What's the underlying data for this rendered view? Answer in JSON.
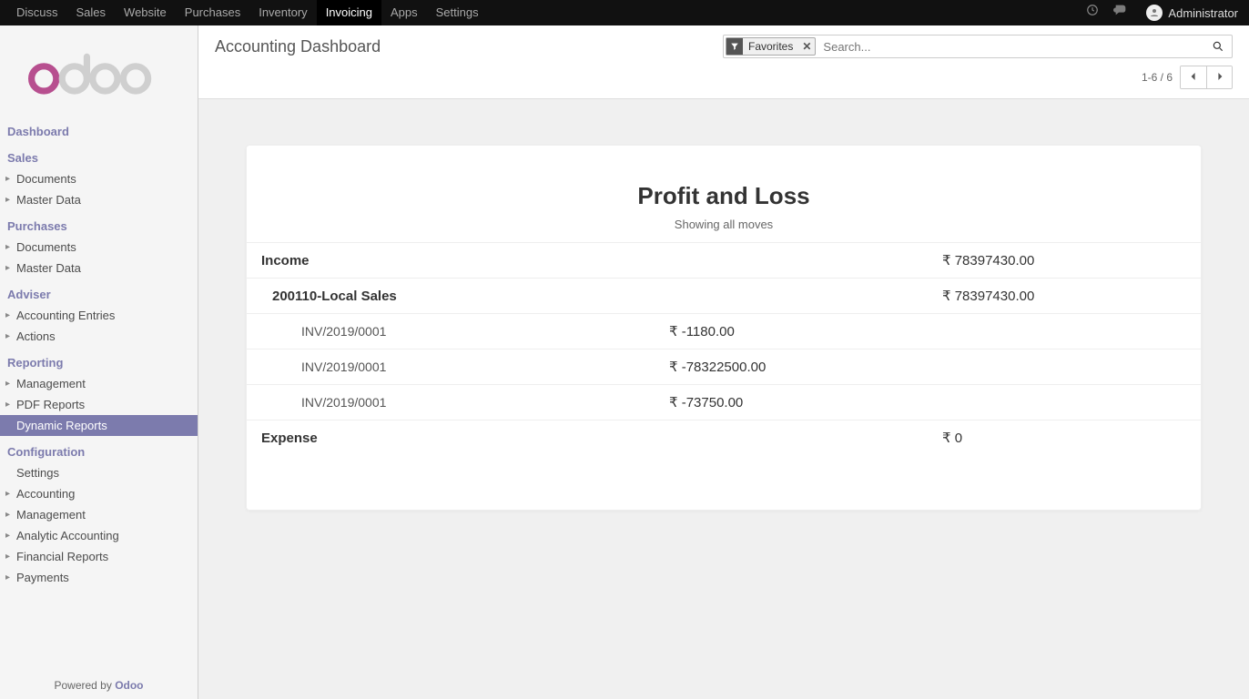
{
  "topmenu": {
    "items": [
      "Discuss",
      "Sales",
      "Website",
      "Purchases",
      "Inventory",
      "Invoicing",
      "Apps",
      "Settings"
    ],
    "active_index": 5,
    "user": "Administrator"
  },
  "sidebar": {
    "groups": [
      {
        "header": "Dashboard",
        "items": []
      },
      {
        "header": "Sales",
        "items": [
          {
            "label": "Documents",
            "caret": true
          },
          {
            "label": "Master Data",
            "caret": true
          }
        ]
      },
      {
        "header": "Purchases",
        "items": [
          {
            "label": "Documents",
            "caret": true
          },
          {
            "label": "Master Data",
            "caret": true
          }
        ]
      },
      {
        "header": "Adviser",
        "items": [
          {
            "label": "Accounting Entries",
            "caret": true
          },
          {
            "label": "Actions",
            "caret": true
          }
        ]
      },
      {
        "header": "Reporting",
        "items": [
          {
            "label": "Management",
            "caret": true
          },
          {
            "label": "PDF Reports",
            "caret": true
          },
          {
            "label": "Dynamic Reports",
            "caret": false,
            "active": true
          }
        ]
      },
      {
        "header": "Configuration",
        "items": [
          {
            "label": "Settings",
            "caret": false
          },
          {
            "label": "Accounting",
            "caret": true
          },
          {
            "label": "Management",
            "caret": true
          },
          {
            "label": "Analytic Accounting",
            "caret": true
          },
          {
            "label": "Financial Reports",
            "caret": true
          },
          {
            "label": "Payments",
            "caret": true
          }
        ]
      }
    ],
    "footer_prefix": "Powered by ",
    "footer_brand": "Odoo"
  },
  "breadcrumb": "Accounting Dashboard",
  "search": {
    "facet_label": "Favorites",
    "placeholder": "Search..."
  },
  "pager": {
    "text": "1-6 / 6"
  },
  "report": {
    "title": "Profit and Loss",
    "subtitle": "Showing all moves",
    "currency_symbol": "₹",
    "rows": [
      {
        "level": 0,
        "label": "Income",
        "amount_col": "right",
        "amount": "78397430.00"
      },
      {
        "level": 1,
        "label": "200110-Local Sales",
        "amount_col": "right",
        "amount": "78397430.00"
      },
      {
        "level": 2,
        "label": "INV/2019/0001",
        "amount_col": "mid",
        "amount": "-1180.00"
      },
      {
        "level": 2,
        "label": "INV/2019/0001",
        "amount_col": "mid",
        "amount": "-78322500.00"
      },
      {
        "level": 2,
        "label": "INV/2019/0001",
        "amount_col": "mid",
        "amount": "-73750.00"
      },
      {
        "level": 0,
        "label": "Expense",
        "amount_col": "right",
        "amount": "0"
      }
    ]
  }
}
